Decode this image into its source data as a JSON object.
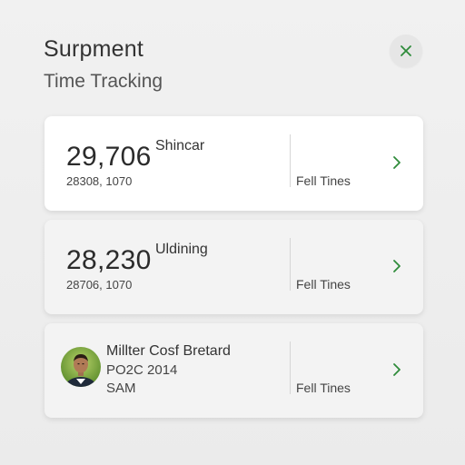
{
  "header": {
    "title": "Surpment",
    "subtitle": "Time Tracking",
    "close_icon": "close-icon"
  },
  "colors": {
    "accent": "#2e8b3a",
    "card_active": "#ffffff",
    "card_inactive": "#f3f3f3"
  },
  "cards": [
    {
      "big_number": "29,706",
      "label": "Shincar",
      "small_number": "28308, 1070",
      "side_label": "Fell Tines",
      "icon": "chevron-right-icon"
    },
    {
      "big_number": "28,230",
      "label": "Uldining",
      "small_number": "28706, 1070",
      "side_label": "Fell Tines",
      "icon": "chevron-right-icon"
    },
    {
      "name": "Millter Cosf Bretard",
      "date": "PO2C 2014",
      "time": "SAM",
      "side_label": "Fell Tines",
      "avatar": "avatar-photo",
      "icon": "chevron-right-icon"
    }
  ]
}
